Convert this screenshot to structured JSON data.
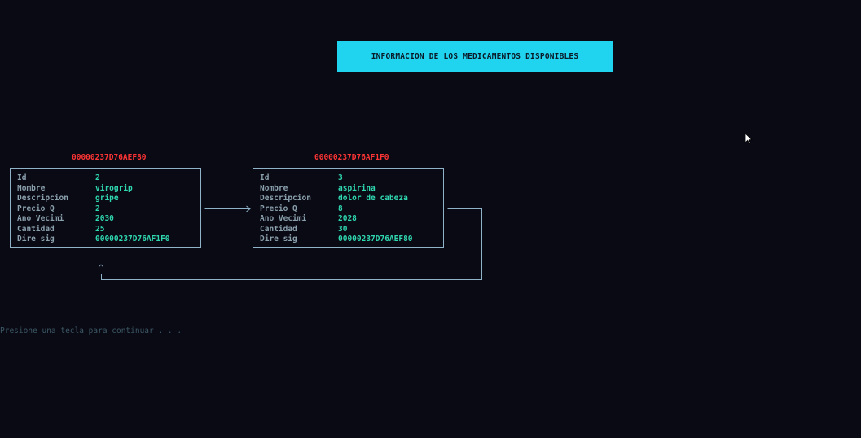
{
  "banner": {
    "title": "INFORMACION DE LOS MEDICAMENTOS DISPONIBLES"
  },
  "field_labels": {
    "id": "Id",
    "nombre": "Nombre",
    "descripcion": "Descripcion",
    "precio": "Precio Q",
    "ano": "Ano Vecimi",
    "cantidad": "Cantidad",
    "dire": "Dire sig"
  },
  "nodes": [
    {
      "address": "00000237D76AEF80",
      "id": "2",
      "nombre": "virogrip",
      "descripcion": "gripe",
      "precio": "2",
      "ano": "2030",
      "cantidad": "25",
      "dire": "00000237D76AF1F0"
    },
    {
      "address": "00000237D76AF1F0",
      "id": "3",
      "nombre": "aspirina",
      "descripcion": "dolor de cabeza",
      "precio": "8",
      "ano": "2028",
      "cantidad": "30",
      "dire": "00000237D76AEF80"
    }
  ],
  "links": {
    "caret": "^",
    "line_color": "#8fb3c8"
  },
  "prompt": "Presione una tecla para continuar . . .",
  "colors": {
    "background": "#0a0a14",
    "banner": "#20d3ef",
    "address": "#ff3434",
    "value": "#2fd7b0",
    "label": "#8aa0ad"
  }
}
